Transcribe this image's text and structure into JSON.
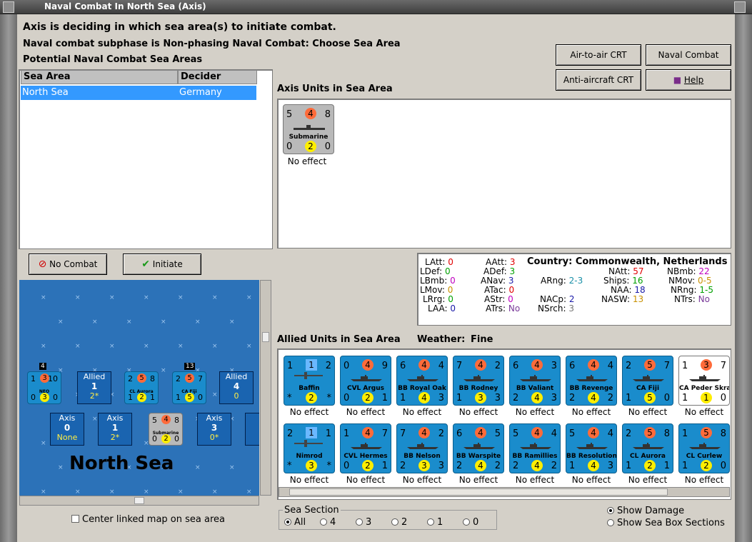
{
  "window": {
    "title": "Naval Combat In North Sea (Axis)"
  },
  "header": {
    "line1": "Axis is deciding in which sea area(s) to initiate combat.",
    "line2": "Naval combat subphase is Non-phasing Naval Combat: Choose Sea Area",
    "line3": "Potential Naval Combat Sea Areas"
  },
  "buttons": {
    "air_to_air": "Air-to-air CRT",
    "naval_chart": "Naval Combat Chart",
    "anti_aircraft": "Anti-aircraft CRT",
    "help": "Help",
    "no_combat": "No Combat",
    "initiate": "Initiate Combat"
  },
  "list": {
    "col_sea": "Sea Area",
    "col_decider": "Decider",
    "rows": [
      {
        "sea": "North Sea",
        "decider": "Germany"
      }
    ]
  },
  "axis_units": {
    "title": "Axis Units in Sea Area",
    "unit": {
      "tl": "5",
      "tm": "4",
      "tr": "8",
      "name": "Submarine",
      "bl": "0",
      "bm": "2",
      "br": "0",
      "effect": "No effect"
    }
  },
  "stats": {
    "latt_l": "LAtt:",
    "latt_v": "0",
    "ldef_l": "LDef:",
    "ldef_v": "0",
    "lbmb_l": "LBmb:",
    "lbmb_v": "0",
    "lmov_l": "LMov:",
    "lmov_v": "0",
    "lrrg_l": "LRrg:",
    "lrrg_v": "0",
    "laa_l": "LAA:",
    "laa_v": "0",
    "aatt_l": "AAtt:",
    "aatt_v": "3",
    "adef_l": "ADef:",
    "adef_v": "3",
    "anav_l": "ANav:",
    "anav_v": "3",
    "atac_l": "ATac:",
    "atac_v": "0",
    "astr_l": "AStr:",
    "astr_v": "0",
    "atrs_l": "ATrs:",
    "atrs_v": "No",
    "country_l": "Country:",
    "country_v": "Commonwealth, Netherlands",
    "arng_l": "ARng:",
    "arng_v": "2-3",
    "nacp_l": "NACp:",
    "nacp_v": "2",
    "nsrch_l": "NSrch:",
    "nsrch_v": "3",
    "natt_l": "NAtt:",
    "natt_v": "57",
    "ships_l": "Ships:",
    "ships_v": "16",
    "naa_l": "NAA:",
    "naa_v": "18",
    "nasw_l": "NASW:",
    "nasw_v": "13",
    "nbmb_l": "NBmb:",
    "nbmb_v": "22",
    "nmov_l": "NMov:",
    "nmov_v": "0-5",
    "nrng_l": "NRng:",
    "nrng_v": "1-5",
    "ntrs_l": "NTrs:",
    "ntrs_v": "No"
  },
  "allied": {
    "title": "Allied Units in Sea Area",
    "weather_label": "Weather:",
    "weather": "Fine",
    "row1": [
      {
        "tl": "1",
        "tm": "1",
        "tr": "2",
        "name": "Baffin",
        "bl": "*",
        "bm": "2",
        "br": "*",
        "effect": "No effect",
        "kind": "air"
      },
      {
        "tl": "0",
        "tm": "4",
        "tr": "9",
        "name": "CVL Argus",
        "bl": "0",
        "bm": "2",
        "br": "1",
        "effect": "No effect"
      },
      {
        "tl": "6",
        "tm": "4",
        "tr": "4",
        "name": "BB Royal Oak",
        "bl": "1",
        "bm": "4",
        "br": "3",
        "effect": "No effect"
      },
      {
        "tl": "7",
        "tm": "4",
        "tr": "2",
        "name": "BB Rodney",
        "bl": "1",
        "bm": "3",
        "br": "3",
        "effect": "No effect"
      },
      {
        "tl": "6",
        "tm": "4",
        "tr": "3",
        "name": "BB Valiant",
        "bl": "2",
        "bm": "4",
        "br": "3",
        "effect": "No effect"
      },
      {
        "tl": "6",
        "tm": "4",
        "tr": "4",
        "name": "BB Revenge",
        "bl": "2",
        "bm": "4",
        "br": "2",
        "effect": "No effect"
      },
      {
        "tl": "2",
        "tm": "5",
        "tr": "7",
        "name": "CA Fiji",
        "bl": "1",
        "bm": "5",
        "br": "0",
        "effect": "No effect"
      },
      {
        "tl": "1",
        "tm": "3",
        "tr": "7",
        "name": "CA Peder Skram",
        "bl": "1",
        "bm": "1",
        "br": "0",
        "effect": "No effect",
        "kind": "white"
      }
    ],
    "row2": [
      {
        "tl": "2",
        "tm": "1",
        "tr": "1",
        "name": "Nimrod",
        "bl": "*",
        "bm": "3",
        "br": "*",
        "effect": "No effect",
        "kind": "air"
      },
      {
        "tl": "1",
        "tm": "4",
        "tr": "7",
        "name": "CVL Hermes",
        "bl": "0",
        "bm": "2",
        "br": "1",
        "effect": "No effect"
      },
      {
        "tl": "7",
        "tm": "4",
        "tr": "2",
        "name": "BB Nelson",
        "bl": "2",
        "bm": "3",
        "br": "3",
        "effect": "No effect"
      },
      {
        "tl": "6",
        "tm": "4",
        "tr": "5",
        "name": "BB Warspite",
        "bl": "2",
        "bm": "4",
        "br": "2",
        "effect": "No effect"
      },
      {
        "tl": "5",
        "tm": "4",
        "tr": "4",
        "name": "BB Ramillies",
        "bl": "2",
        "bm": "4",
        "br": "2",
        "effect": "No effect"
      },
      {
        "tl": "5",
        "tm": "4",
        "tr": "4",
        "name": "BB Resolution",
        "bl": "1",
        "bm": "4",
        "br": "3",
        "effect": "No effect"
      },
      {
        "tl": "2",
        "tm": "5",
        "tr": "8",
        "name": "CL Aurora",
        "bl": "1",
        "bm": "2",
        "br": "1",
        "effect": "No effect"
      },
      {
        "tl": "1",
        "tm": "5",
        "tr": "8",
        "name": "CL Curlew",
        "bl": "1",
        "bm": "2",
        "br": "0",
        "effect": "No effect"
      }
    ]
  },
  "map": {
    "name": "North Sea",
    "allied_boxes": [
      {
        "label": "Allied",
        "num": "1",
        "sub": "2*"
      },
      {
        "label": "Allied",
        "num": "4",
        "sub": "0"
      }
    ],
    "axis_boxes": [
      {
        "label": "Axis",
        "num": "0",
        "sub": "None"
      },
      {
        "label": "Axis",
        "num": "1",
        "sub": "2*"
      },
      {
        "label": "Axis",
        "num": "3",
        "sub": "0*"
      },
      {
        "label": "A"
      }
    ],
    "stack_counts": [
      "4",
      "13"
    ],
    "mini": [
      {
        "tl": "1",
        "tm": "3",
        "tr": "10",
        "name": "NEO",
        "bl": "0",
        "bm": "3",
        "br": "0"
      },
      {
        "tl": "2",
        "tm": "5",
        "tr": "8",
        "name": "CL Aurora",
        "bl": "1",
        "bm": "2",
        "br": "1"
      },
      {
        "tl": "2",
        "tm": "5",
        "tr": "7",
        "name": "CA Fiji",
        "bl": "1",
        "bm": "5",
        "br": "0"
      },
      {
        "tl": "5",
        "tm": "4",
        "tr": "8",
        "name": "Submarine",
        "bl": "0",
        "bm": "2",
        "br": "0"
      }
    ]
  },
  "options": {
    "center_map": "Center linked map on sea area",
    "sea_section": "Sea Section",
    "radios": [
      "All",
      "4",
      "3",
      "2",
      "1",
      "0"
    ],
    "show_damage": "Show Damage",
    "show_boxes": "Show Sea Box Sections"
  }
}
